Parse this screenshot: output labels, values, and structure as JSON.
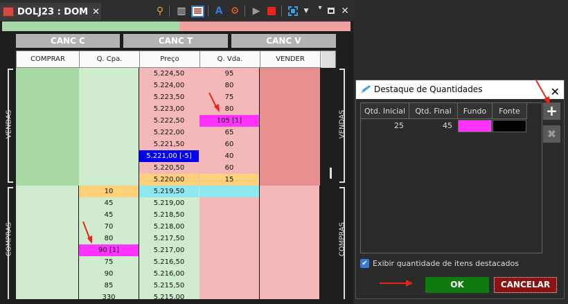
{
  "tab": {
    "title": "DOLJ23 : DOM",
    "close": "✕"
  },
  "toolbar": {
    "icons": [
      "key-filter-icon",
      "columns-icon",
      "grid-icon",
      "edit-text-icon",
      "gear-icon",
      "play-icon",
      "stop-icon",
      "select-icon",
      "dropdown-icon",
      "pin-icon",
      "maximize-icon",
      "close-icon"
    ]
  },
  "canc": {
    "c": "CANC C",
    "t": "CANC T",
    "v": "CANC V"
  },
  "headers": {
    "comprar": "COMPRAR",
    "qcpa": "Q. Cpa.",
    "preco": "Preço",
    "qvda": "Q. Vda.",
    "vender": "VENDER"
  },
  "side": {
    "vendas": "VENDAS",
    "compras": "COMPRAS"
  },
  "sell_rows": [
    {
      "preco": "5.224,50",
      "qvda": "95"
    },
    {
      "preco": "5.224,00",
      "qvda": "80"
    },
    {
      "preco": "5.223,50",
      "qvda": "75"
    },
    {
      "preco": "5.223,00",
      "qvda": "80"
    },
    {
      "preco": "5.222,50",
      "qvda": "105 [1]"
    },
    {
      "preco": "5.222,00",
      "qvda": "65"
    },
    {
      "preco": "5.221,50",
      "qvda": "60"
    },
    {
      "preco": "5.221,00 [-5]",
      "qvda": "40"
    },
    {
      "preco": "5.220,50",
      "qvda": "60"
    },
    {
      "preco": "5.220,00",
      "qvda": "15"
    }
  ],
  "buy_rows": [
    {
      "preco": "5.219,50",
      "qcpa": "10"
    },
    {
      "preco": "5.219,00",
      "qcpa": "45"
    },
    {
      "preco": "5.218,50",
      "qcpa": "45"
    },
    {
      "preco": "5.218,00",
      "qcpa": "70"
    },
    {
      "preco": "5.217,50",
      "qcpa": "80"
    },
    {
      "preco": "5.217,00",
      "qcpa": "90 [1]"
    },
    {
      "preco": "5.216,50",
      "qcpa": "75"
    },
    {
      "preco": "5.216,00",
      "qcpa": "90"
    },
    {
      "preco": "5.215,50",
      "qcpa": "85"
    },
    {
      "preco": "5.215,00",
      "qcpa": "330"
    }
  ],
  "dialog": {
    "title": "Destaque de Quantidades",
    "close": "✕",
    "cols": {
      "qtd_inicial": "Qtd. Inicial",
      "qtd_final": "Qtd. Final",
      "fundo": "Fundo",
      "fonte": "Fonte"
    },
    "row": {
      "qtd_inicial": "25",
      "qtd_final": "45",
      "fundo_color": "#ff33ff",
      "fonte_color": "#000000"
    },
    "add": "+",
    "remove": "✖",
    "checkbox_label": "Exibir quantidade de itens destacados",
    "ok": "OK",
    "cancel": "CANCELAR"
  },
  "colors": {
    "buy_green": "#a6d9a6",
    "buy_light": "#cfeccf",
    "sell_pink": "#f4b8b8",
    "sell_dark": "#e89090",
    "highlight_magenta": "#ff33ff",
    "last_price_blue": "#0000ee",
    "best_bid_cyan": "#8ee8f0",
    "best_ask_orange": "#ffd07a",
    "arrow_red": "#e8231a"
  }
}
